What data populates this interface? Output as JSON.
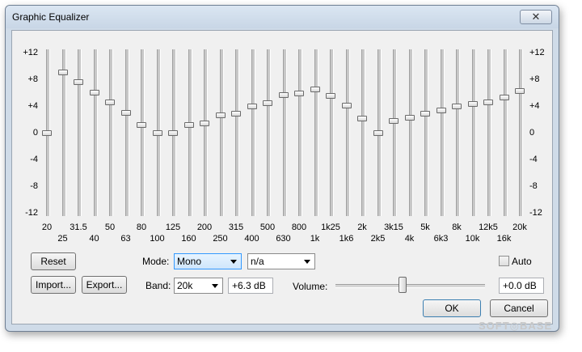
{
  "window": {
    "title": "Graphic Equalizer",
    "close_glyph": "✕"
  },
  "scale": {
    "min": -12,
    "max": 12,
    "labels": [
      "+12",
      "+8",
      "+4",
      "0",
      "-4",
      "-8",
      "-12"
    ]
  },
  "bands": [
    {
      "freq": "20",
      "gain_db": 0.0
    },
    {
      "freq": "25",
      "gain_db": 9.0
    },
    {
      "freq": "31.5",
      "gain_db": 7.6
    },
    {
      "freq": "40",
      "gain_db": 6.0
    },
    {
      "freq": "50",
      "gain_db": 4.5
    },
    {
      "freq": "63",
      "gain_db": 3.0
    },
    {
      "freq": "80",
      "gain_db": 1.1
    },
    {
      "freq": "100",
      "gain_db": 0.0
    },
    {
      "freq": "125",
      "gain_db": 0.0
    },
    {
      "freq": "160",
      "gain_db": 1.1
    },
    {
      "freq": "200",
      "gain_db": 1.4
    },
    {
      "freq": "250",
      "gain_db": 2.6
    },
    {
      "freq": "315",
      "gain_db": 2.8
    },
    {
      "freq": "400",
      "gain_db": 4.0
    },
    {
      "freq": "500",
      "gain_db": 4.4
    },
    {
      "freq": "630",
      "gain_db": 5.6
    },
    {
      "freq": "800",
      "gain_db": 5.9
    },
    {
      "freq": "1k",
      "gain_db": 6.5
    },
    {
      "freq": "1k25",
      "gain_db": 5.5
    },
    {
      "freq": "1k6",
      "gain_db": 4.1
    },
    {
      "freq": "2k",
      "gain_db": 2.1
    },
    {
      "freq": "2k5",
      "gain_db": 0.0
    },
    {
      "freq": "3k15",
      "gain_db": 1.7
    },
    {
      "freq": "4k",
      "gain_db": 2.2
    },
    {
      "freq": "5k",
      "gain_db": 2.8
    },
    {
      "freq": "6k3",
      "gain_db": 3.3
    },
    {
      "freq": "8k",
      "gain_db": 4.0
    },
    {
      "freq": "10k",
      "gain_db": 4.3
    },
    {
      "freq": "12k5",
      "gain_db": 4.6
    },
    {
      "freq": "16k",
      "gain_db": 5.3
    },
    {
      "freq": "20k",
      "gain_db": 6.3
    }
  ],
  "controls": {
    "reset_label": "Reset",
    "import_label": "Import...",
    "export_label": "Export...",
    "mode_label": "Mode:",
    "mode_value": "Mono",
    "channel_value": "n/a",
    "auto_label": "Auto",
    "auto_checked": false,
    "band_label": "Band:",
    "band_value": "20k",
    "band_gain_text": "+6.3 dB",
    "volume_label": "Volume:",
    "volume_position": 0.45,
    "volume_text": "+0.0 dB",
    "ok_label": "OK",
    "cancel_label": "Cancel"
  },
  "watermark": "SOFT◎BASE"
}
